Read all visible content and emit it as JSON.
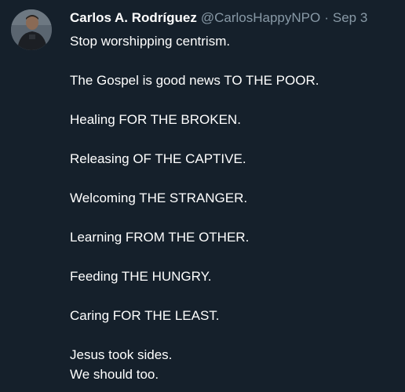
{
  "tweet": {
    "author_name": "Carlos A. Rodríguez",
    "handle": "@CarlosHappyNPO",
    "separator": "·",
    "date": "Sep 3",
    "paragraphs": [
      "Stop worshipping centrism.",
      "The Gospel is good news TO THE POOR.",
      "Healing FOR THE BROKEN.",
      "Releasing OF THE CAPTIVE.",
      "Welcoming THE STRANGER.",
      "Learning FROM THE OTHER.",
      "Feeding THE HUNGRY.",
      "Caring FOR THE LEAST."
    ],
    "closing_lines": [
      "Jesus took sides.",
      "We should too."
    ]
  },
  "colors": {
    "background": "#15202b",
    "primary_text": "#ffffff",
    "secondary_text": "#8899a6"
  }
}
